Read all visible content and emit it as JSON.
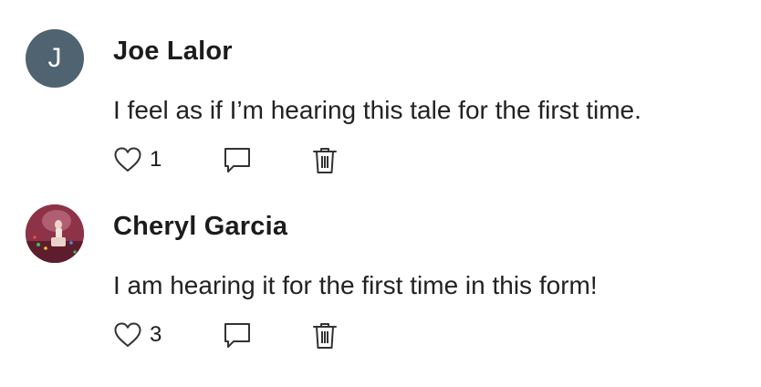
{
  "comments": [
    {
      "author": "Joe Lalor",
      "avatar_letter": "J",
      "avatar_color": "#4f6370",
      "text": "I feel as if I’m hearing this tale for the first time.",
      "likes": "1"
    },
    {
      "author": "Cheryl Garcia",
      "avatar_type": "photo",
      "text": "I am hearing it for the first time in this form!",
      "likes": "3"
    }
  ],
  "icons": {
    "like": "heart-icon",
    "reply": "speech-bubble-icon",
    "delete": "trash-icon"
  }
}
